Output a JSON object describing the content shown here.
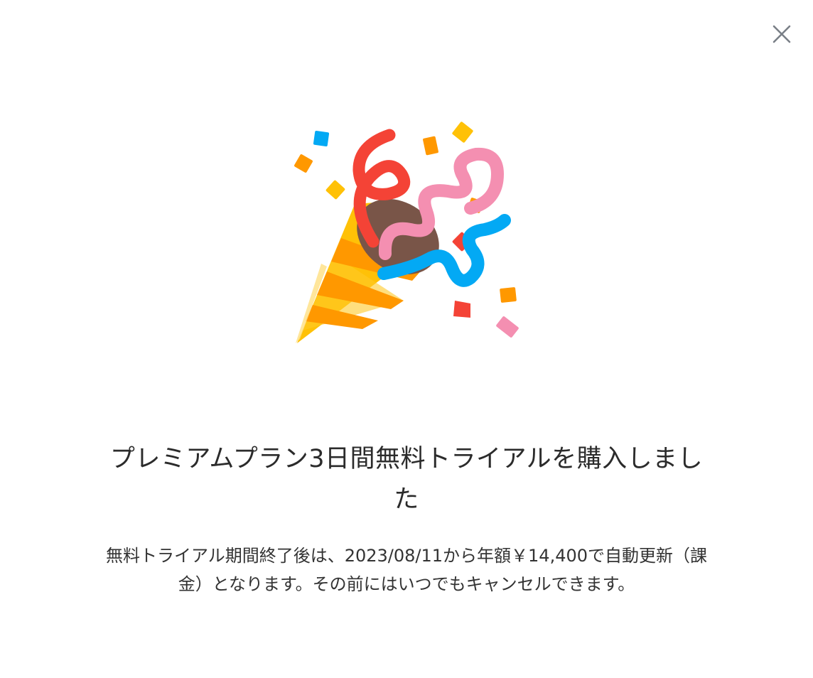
{
  "dialog": {
    "close_icon": "close-icon",
    "illustration_icon": "party-popper-icon",
    "title": "プレミアムプラン3日間無料トライアルを購入しました",
    "description": "無料トライアル期間終了後は、2023/08/11から年額￥14,400で自動更新（課金）となります。その前にはいつでもキャンセルできます。"
  },
  "colors": {
    "background": "#ffffff",
    "title_text": "#2b2b2b",
    "body_text": "#333333",
    "close_icon": "#7a7f87"
  }
}
